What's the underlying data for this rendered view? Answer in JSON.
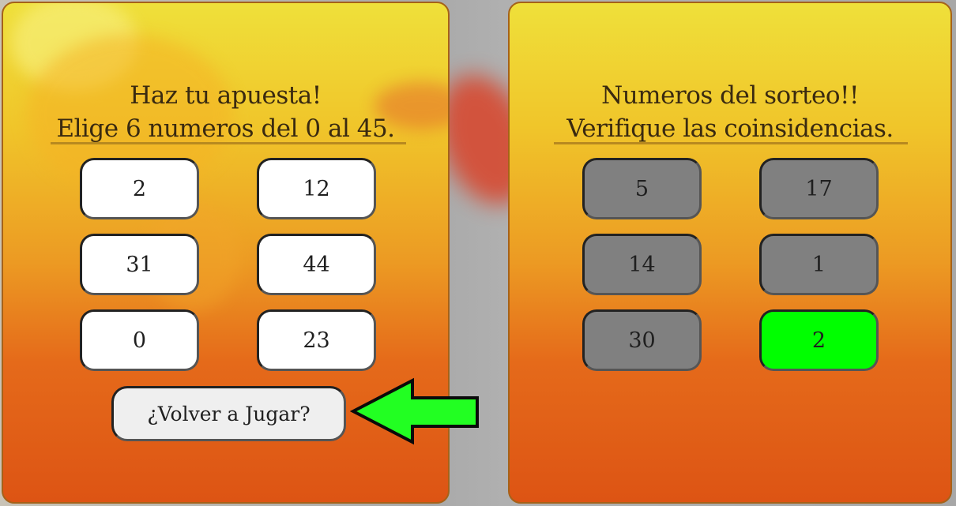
{
  "left_panel": {
    "title_line1": "Haz tu apuesta!",
    "title_line2": "Elige 6 numeros del 0 al 45.",
    "numbers": [
      "2",
      "12",
      "31",
      "44",
      "0",
      "23"
    ],
    "replay_label": "¿Volver a Jugar?"
  },
  "right_panel": {
    "title_line1": "Numeros del sorteo!!",
    "title_line2": "Verifique las coinsidencias.",
    "numbers": [
      "5",
      "17",
      "14",
      "1",
      "30",
      "2"
    ],
    "match_index": 5
  },
  "colors": {
    "pick_box": "#ffffff",
    "draw_box": "#808080",
    "match_box": "#00ff00",
    "arrow": "#22ff22"
  },
  "icons": {
    "arrow": "left-arrow-icon"
  }
}
